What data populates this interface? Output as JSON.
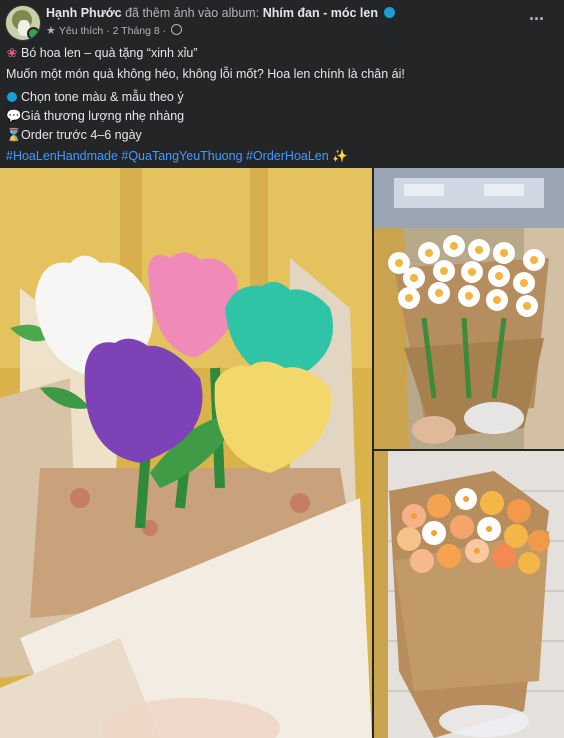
{
  "header": {
    "author": "Hạnh Phước",
    "action": "đã thêm ảnh vào album:",
    "album": "Nhím đan - móc len",
    "relationship": "Yêu thích",
    "date": "2 Tháng 8",
    "separator": "·",
    "more_icon": "more-horizontal-icon"
  },
  "post": {
    "title": "Bó hoa len – quà tặng “xinh xỉu”",
    "tagline": "Muốn một món quà không héo, không lỗi mốt? Hoa len chính là chân ái!",
    "bullets": [
      {
        "icon": "blue-dot-icon",
        "text": "Chọn tone màu & mẫu theo ý"
      },
      {
        "icon": "speech-bubble-icon",
        "text": "Giá thương lượng nhẹ nhàng"
      },
      {
        "icon": "hourglass-icon",
        "text": "Order trước 4–6 ngày"
      }
    ],
    "hashtags": "#HoaLenHandmade #QuaTangYeuThuong #OrderHoaLen",
    "sparkle": "✨"
  },
  "photos": [
    {
      "name": "tulip-bouquet-photo"
    },
    {
      "name": "daisy-bouquet-photo"
    },
    {
      "name": "pastel-flower-bouquet-photo"
    }
  ],
  "colors": {
    "background": "#242526",
    "text": "#e4e6eb",
    "secondary": "#b0b3b8",
    "hashtag": "#4599ff"
  }
}
